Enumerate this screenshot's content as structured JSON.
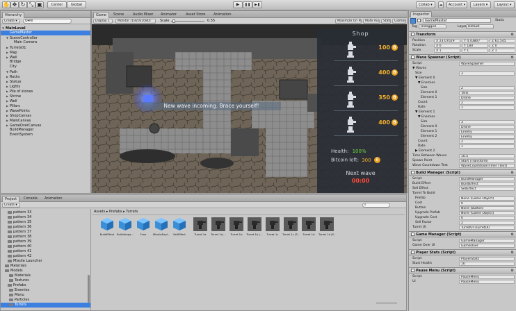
{
  "toolbar": {
    "tool_icons": [
      "hand-icon",
      "move-icon",
      "rotate-icon",
      "scale-icon",
      "rect-icon"
    ],
    "center_label": "Center",
    "global_label": "Global",
    "play": "▶",
    "pause": "❚❚",
    "step": "▶❚",
    "collab": "Collab ▾",
    "account": "Account ▾",
    "layers": "Layers ▾",
    "layout": "Layout ▾"
  },
  "hierarchy": {
    "tab": "Hierarchy",
    "create": "Create ▾",
    "search_placeholder": "Q▾All",
    "items": [
      {
        "label": "MainLevel",
        "indent": 0,
        "arrow": "▼",
        "selected": false,
        "bold": true
      },
      {
        "label": "GameMaster",
        "indent": 1,
        "arrow": "",
        "selected": true
      },
      {
        "label": "SceneController",
        "indent": 1,
        "arrow": "▼",
        "selected": false
      },
      {
        "label": "Main Camera",
        "indent": 2,
        "arrow": "",
        "selected": false
      },
      {
        "label": "Turrets01",
        "indent": 1,
        "arrow": "▶",
        "selected": false
      },
      {
        "label": "Map",
        "indent": 1,
        "arrow": "▶",
        "selected": false
      },
      {
        "label": "Wall",
        "indent": 1,
        "arrow": "▶",
        "selected": false
      },
      {
        "label": "Bridge",
        "indent": 1,
        "arrow": "",
        "selected": false
      },
      {
        "label": "City",
        "indent": 1,
        "arrow": "",
        "selected": false
      },
      {
        "label": "Path",
        "indent": 1,
        "arrow": "▼",
        "selected": false
      },
      {
        "label": "Rocks",
        "indent": 1,
        "arrow": "▶",
        "selected": false
      },
      {
        "label": "Statue",
        "indent": 1,
        "arrow": "▶",
        "selected": false
      },
      {
        "label": "Lights",
        "indent": 1,
        "arrow": "▶",
        "selected": false
      },
      {
        "label": "Pile of stones",
        "indent": 1,
        "arrow": "▶",
        "selected": false
      },
      {
        "label": "Shrine",
        "indent": 1,
        "arrow": "▶",
        "selected": false
      },
      {
        "label": "Well",
        "indent": 1,
        "arrow": "▶",
        "selected": false
      },
      {
        "label": "Pillars",
        "indent": 1,
        "arrow": "▶",
        "selected": false
      },
      {
        "label": "WavePoints",
        "indent": 1,
        "arrow": "▶",
        "selected": false
      },
      {
        "label": "ShopCanvas",
        "indent": 1,
        "arrow": "▶",
        "selected": false
      },
      {
        "label": "MainCanvas",
        "indent": 1,
        "arrow": "▶",
        "selected": false
      },
      {
        "label": "GameOverCanvas",
        "indent": 1,
        "arrow": "▶",
        "selected": false
      },
      {
        "label": "BuildManager",
        "indent": 1,
        "arrow": "",
        "selected": false
      },
      {
        "label": "EventSystem",
        "indent": 1,
        "arrow": "",
        "selected": false
      }
    ]
  },
  "game_view": {
    "tabs": [
      "Game",
      "Scene",
      "Audio Mixer",
      "Animator",
      "Asset Store",
      "Animation"
    ],
    "display": "Display 1",
    "resolution": "Monitor (1920x1080)",
    "scale_label": "Scale",
    "scale_value": "0.55",
    "maximize": "Maximize On Play",
    "mute": "Mute Audio",
    "stats": "Stats",
    "gizmos": "Gizmos ▾",
    "banner": "New wave incoming. Brace yourself!",
    "shop": {
      "title": "Shop",
      "prices": [
        "100",
        "400",
        "350",
        "400"
      ],
      "health_label": "Health:",
      "health_value": "100%",
      "bitcoin_label": "Bitcoin left:",
      "bitcoin_value": "300",
      "next_wave_label": "Next wave",
      "next_wave_value": "00:00"
    }
  },
  "project": {
    "tabs": [
      "Project",
      "Console",
      "Animation"
    ],
    "create": "Create ▾",
    "breadcrumb": "Assets ▸ Prefabs ▸ Turrets",
    "folders": [
      "pattern 33",
      "pattern 34",
      "pattern 35",
      "pattern 36",
      "pattern 37",
      "pattern 38",
      "pattern 39",
      "pattern 40",
      "pattern 41",
      "pattern 42",
      "Missile Launcher",
      "Materials",
      "Models",
      "Materials",
      "Textures",
      "Prefabs",
      "Enemies",
      "Menu",
      "Particles",
      "Turrets"
    ],
    "assets": [
      "BuildEffect",
      "BulletImpa...",
      "Fuse",
      "MissileExpl...",
      "SellEffect",
      "Turret 1a",
      "Turret 1c(...",
      "Turret 1b",
      "Turret 1b (...",
      "Turret 1c",
      "Turret 1c (S...",
      "Turret 1d",
      "Turret 1d (S..."
    ]
  },
  "inspector": {
    "tab": "Inspector",
    "object_name": "GameMaster",
    "static": "Static",
    "tag_label": "Tag",
    "tag": "Untagged",
    "layer_label": "Layer",
    "layer": "Default",
    "transform": {
      "title": "Transform",
      "position_label": "Position",
      "rotation_label": "Rotation",
      "scale_label": "Scale",
      "position": [
        "X 23.07029",
        "Y 4.43807",
        "Z 61.545"
      ],
      "rotation": [
        "X 0",
        "Y 180",
        "Z 0"
      ],
      "scale": [
        "X 1",
        "Y 1",
        "Z 1"
      ]
    },
    "wave_spawner": {
      "title": "Wave Spawner (Script)",
      "rows": [
        {
          "label": "Script",
          "value": "WaveSpawner",
          "indent": 0
        },
        {
          "label": "▼ Waves",
          "value": "",
          "indent": 0
        },
        {
          "label": "Size",
          "value": "3",
          "indent": 1
        },
        {
          "label": "▼ Element 0",
          "value": "",
          "indent": 1
        },
        {
          "label": "▼ Enemies",
          "value": "",
          "indent": 2
        },
        {
          "label": "Size",
          "value": "2",
          "indent": 3
        },
        {
          "label": "Element 0",
          "value": "Tank",
          "indent": 3
        },
        {
          "label": "Element 1",
          "value": "Drone",
          "indent": 3
        },
        {
          "label": "Count",
          "value": "2",
          "indent": 2
        },
        {
          "label": "Rate",
          "value": "1",
          "indent": 2
        },
        {
          "label": "▼ Element 1",
          "value": "",
          "indent": 1
        },
        {
          "label": "▼ Enemies",
          "value": "",
          "indent": 2
        },
        {
          "label": "Size",
          "value": "3",
          "indent": 3
        },
        {
          "label": "Element 0",
          "value": "Drone",
          "indent": 3
        },
        {
          "label": "Element 1",
          "value": "Enemy",
          "indent": 3
        },
        {
          "label": "Element 2",
          "value": "Enemy",
          "indent": 3
        },
        {
          "label": "Count",
          "value": "2",
          "indent": 2
        },
        {
          "label": "Rate",
          "value": "1",
          "indent": 2
        },
        {
          "label": "▶ Element 2",
          "value": "",
          "indent": 1
        },
        {
          "label": "Time Between Waves",
          "value": "10.5",
          "indent": 0
        },
        {
          "label": "Spawn Point",
          "value": "Start (Transform)",
          "indent": 0
        },
        {
          "label": "Wave Countdown Text",
          "value": "WaveCountdownTimer (Text)",
          "indent": 0
        }
      ]
    },
    "build_manager": {
      "title": "Build Manager (Script)",
      "rows": [
        {
          "label": "Script",
          "value": "BuildManager",
          "indent": 0
        },
        {
          "label": "Build Effect",
          "value": "BuildEffect",
          "indent": 0
        },
        {
          "label": "Sell Effect",
          "value": "SellEffect",
          "indent": 0
        },
        {
          "label": "Turret To Build",
          "value": "",
          "indent": 0
        },
        {
          "label": "Prefab",
          "value": "None (Game Object)",
          "indent": 1
        },
        {
          "label": "Cost",
          "value": "0",
          "indent": 1
        },
        {
          "label": "Button",
          "value": "None (Button)",
          "indent": 1
        },
        {
          "label": "Upgrade Prefab",
          "value": "None (Game Object)",
          "indent": 1
        },
        {
          "label": "Upgrade Cost",
          "value": "0",
          "indent": 1
        },
        {
          "label": "Sell Factor",
          "value": "2",
          "indent": 1
        },
        {
          "label": "Turret UI",
          "value": "TurretUI (TurretUI)",
          "indent": 0
        }
      ]
    },
    "game_manager": {
      "title": "Game Manager (Script)",
      "rows": [
        {
          "label": "Script",
          "value": "GameManager",
          "indent": 0
        },
        {
          "label": "Game Over UI",
          "value": "GameOver",
          "indent": 0
        }
      ]
    },
    "player_stats": {
      "title": "Player Stats (Script)",
      "rows": [
        {
          "label": "Script",
          "value": "PlayerStats",
          "indent": 0
        },
        {
          "label": "Start Health",
          "value": "10",
          "indent": 0
        }
      ]
    },
    "pause_menu": {
      "title": "Pause Menu (Script)",
      "rows": [
        {
          "label": "Script",
          "value": "PauseMenu",
          "indent": 0
        },
        {
          "label": "Ui",
          "value": "PauseMenu",
          "indent": 0
        }
      ]
    }
  },
  "colors": {
    "selection": "#3d7fe0",
    "shop_price": "#f2b030",
    "health_green": "#6fdc4a",
    "next_wave_red": "#ff4a3a"
  }
}
